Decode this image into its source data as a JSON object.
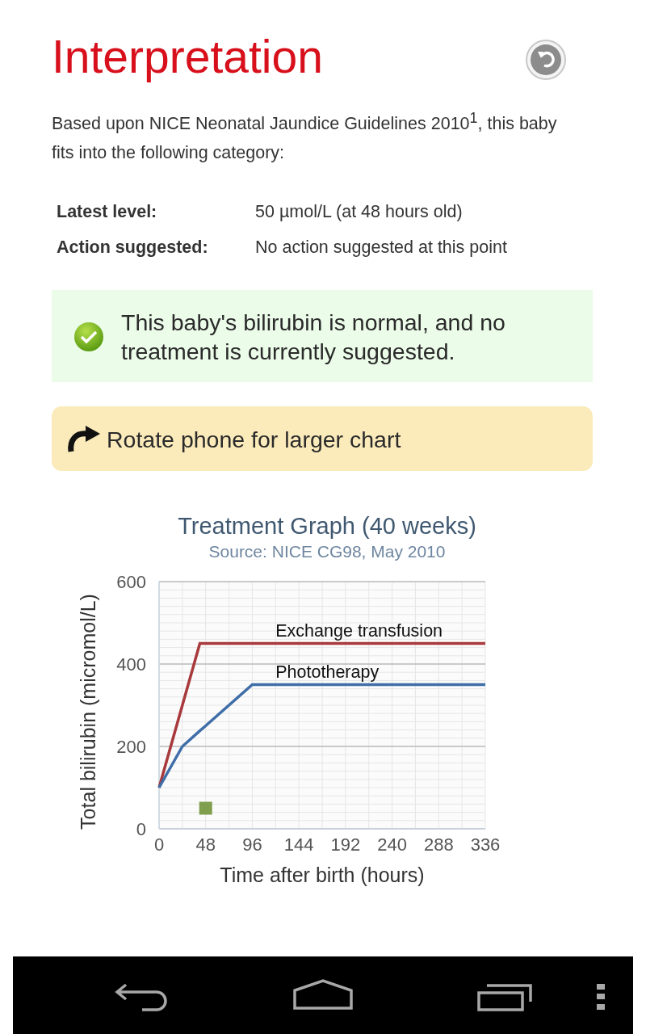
{
  "header": {
    "title": "Interpretation"
  },
  "intro": "Based upon NICE Neonatal Jaundice Guidelines 2010$^{1}$, this baby fits into the following category:",
  "summary": [
    {
      "label": "Latest level:",
      "value": "50 µmol/L (at 48 hours old)"
    },
    {
      "label": "Action suggested:",
      "value": "No action suggested at this point"
    }
  ],
  "result": {
    "message": "This baby's bilirubin is normal, and no treatment is currently suggested."
  },
  "rotate_hint": "Rotate phone for larger chart",
  "chart": {
    "title": "Treatment Graph (40 weeks)",
    "subtitle": "Source: NICE CG98, May 2010",
    "chart_data": {
      "type": "line",
      "xlabel": "Time after birth (hours)",
      "ylabel": "Total bilirubin (micromol/L)",
      "x": [
        0,
        24,
        42,
        48,
        96,
        336
      ],
      "grid": true,
      "series": [
        {
          "name": "Exchange transfusion",
          "color": "#a8393c",
          "values": [
            100,
            300,
            450,
            450,
            450,
            450
          ]
        },
        {
          "name": "Phototherapy",
          "color": "#3f6ea8",
          "values": [
            100,
            200,
            238,
            250,
            350,
            350
          ]
        },
        {
          "color": "#7f9f4f",
          "marker": "square",
          "values": [
            null,
            null,
            null,
            50,
            null,
            null
          ]
        }
      ],
      "xlim": [
        0,
        336
      ],
      "ylim": [
        0,
        600
      ],
      "xticks": [
        0,
        48,
        96,
        144,
        192,
        240,
        288,
        336
      ],
      "yticks": [
        0,
        200,
        400,
        600
      ]
    }
  }
}
